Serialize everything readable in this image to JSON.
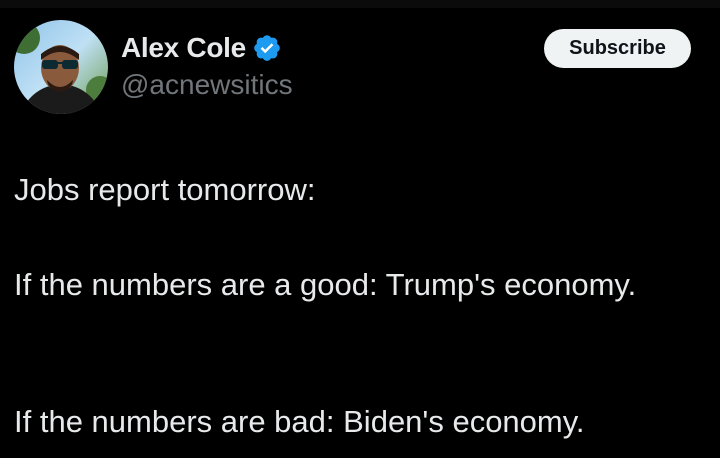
{
  "author": {
    "display_name": "Alex Cole",
    "handle": "@acnewsitics",
    "verified": true
  },
  "actions": {
    "subscribe_label": "Subscribe"
  },
  "tweet": {
    "lines": [
      "Jobs report tomorrow:",
      "If the numbers are a good: Trump's economy.",
      "If the numbers are bad: Biden's economy."
    ]
  },
  "colors": {
    "background": "#000000",
    "text_primary": "#e7e9ea",
    "text_secondary": "#71767b",
    "verified_badge": "#1d9bf0",
    "button_bg": "#eff3f4"
  }
}
